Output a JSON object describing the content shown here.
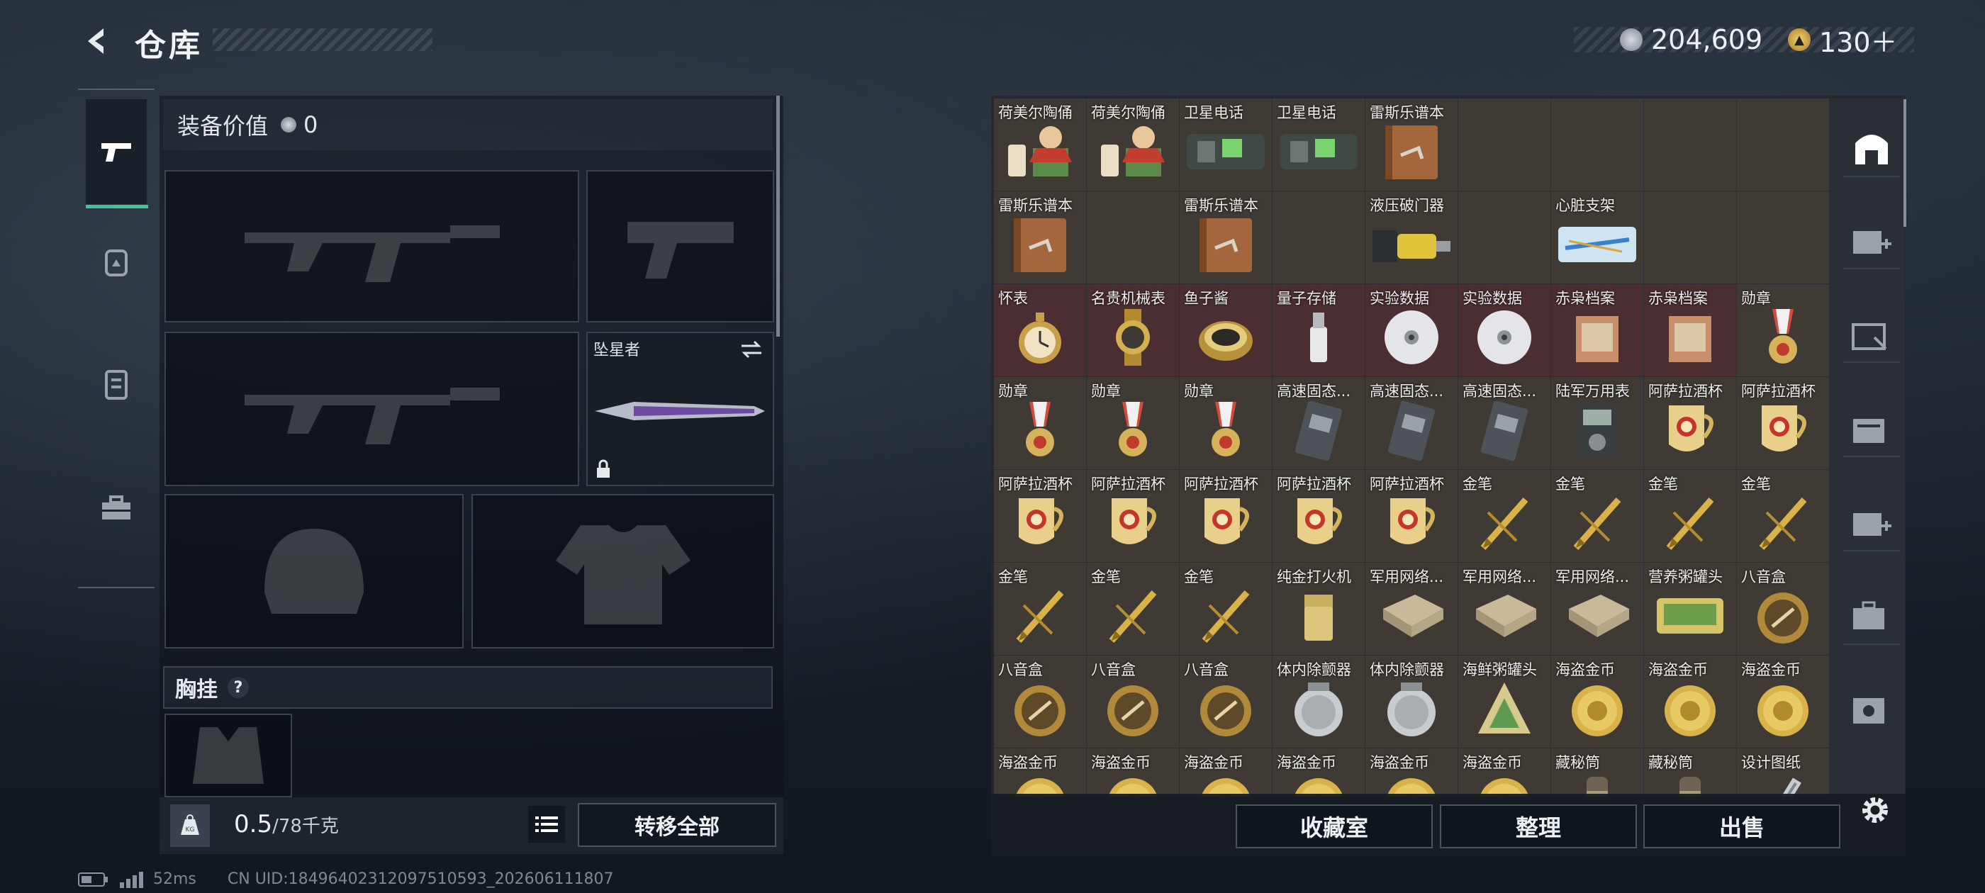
{
  "header": {
    "title": "仓库",
    "currency_silver": "204,609",
    "currency_gold": "130＋"
  },
  "loadout": {
    "value_label": "装备价值",
    "value_amount": "0",
    "melee_label": "坠星者",
    "chest_label": "胸挂",
    "chest_help": "?",
    "weight_current": "0.5",
    "weight_max": "/78千克",
    "transfer_all": "转移全部"
  },
  "inventory": {
    "items": [
      {
        "label": "荷美尔陶俑",
        "icon": "figurine",
        "red": false
      },
      {
        "label": "荷美尔陶俑",
        "icon": "figurine",
        "red": false
      },
      {
        "label": "卫星电话",
        "icon": "phone",
        "red": false
      },
      {
        "label": "卫星电话",
        "icon": "phone",
        "red": false
      },
      {
        "label": "雷斯乐谱本",
        "icon": "book",
        "red": false
      },
      {
        "label": "",
        "icon": "none",
        "red": false
      },
      {
        "label": "",
        "icon": "none",
        "red": false
      },
      {
        "label": "",
        "icon": "none",
        "red": false
      },
      {
        "label": "",
        "icon": "none",
        "red": false
      },
      {
        "label": "雷斯乐谱本",
        "icon": "book",
        "red": false
      },
      {
        "label": "",
        "icon": "none",
        "red": false
      },
      {
        "label": "雷斯乐谱本",
        "icon": "book",
        "red": false
      },
      {
        "label": "",
        "icon": "none",
        "red": false
      },
      {
        "label": "液压破门器",
        "icon": "breacher",
        "red": false
      },
      {
        "label": "",
        "icon": "none",
        "red": false
      },
      {
        "label": "心脏支架",
        "icon": "stent",
        "red": false
      },
      {
        "label": "",
        "icon": "none",
        "red": false
      },
      {
        "label": "",
        "icon": "none",
        "red": false
      },
      {
        "label": "怀表",
        "icon": "watch",
        "red": true
      },
      {
        "label": "名贵机械表",
        "icon": "wristwatch",
        "red": true
      },
      {
        "label": "鱼子酱",
        "icon": "caviar",
        "red": true
      },
      {
        "label": "量子存储",
        "icon": "usb",
        "red": true
      },
      {
        "label": "实验数据",
        "icon": "disc",
        "red": true
      },
      {
        "label": "实验数据",
        "icon": "disc",
        "red": true
      },
      {
        "label": "赤枭档案",
        "icon": "file",
        "red": true
      },
      {
        "label": "赤枭档案",
        "icon": "file",
        "red": true
      },
      {
        "label": "勋章",
        "icon": "medal",
        "red": false
      },
      {
        "label": "勋章",
        "icon": "medal",
        "red": false
      },
      {
        "label": "勋章",
        "icon": "medal",
        "red": false
      },
      {
        "label": "勋章",
        "icon": "medal",
        "red": false
      },
      {
        "label": "高速固态...",
        "icon": "ssd",
        "red": false
      },
      {
        "label": "高速固态...",
        "icon": "ssd",
        "red": false
      },
      {
        "label": "高速固态...",
        "icon": "ssd",
        "red": false
      },
      {
        "label": "陆军万用表",
        "icon": "meter",
        "red": false
      },
      {
        "label": "阿萨拉酒杯",
        "icon": "cup",
        "red": false
      },
      {
        "label": "阿萨拉酒杯",
        "icon": "cup",
        "red": false
      },
      {
        "label": "阿萨拉酒杯",
        "icon": "cup",
        "red": false
      },
      {
        "label": "阿萨拉酒杯",
        "icon": "cup",
        "red": false
      },
      {
        "label": "阿萨拉酒杯",
        "icon": "cup",
        "red": false
      },
      {
        "label": "阿萨拉酒杯",
        "icon": "cup",
        "red": false
      },
      {
        "label": "阿萨拉酒杯",
        "icon": "cup",
        "red": false
      },
      {
        "label": "金笔",
        "icon": "pen",
        "red": false
      },
      {
        "label": "金笔",
        "icon": "pen",
        "red": false
      },
      {
        "label": "金笔",
        "icon": "pen",
        "red": false
      },
      {
        "label": "金笔",
        "icon": "pen",
        "red": false
      },
      {
        "label": "金笔",
        "icon": "pen",
        "red": false
      },
      {
        "label": "金笔",
        "icon": "pen",
        "red": false
      },
      {
        "label": "金笔",
        "icon": "pen",
        "red": false
      },
      {
        "label": "纯金打火机",
        "icon": "lighter",
        "red": false
      },
      {
        "label": "军用网络...",
        "icon": "router",
        "red": false
      },
      {
        "label": "军用网络...",
        "icon": "router",
        "red": false
      },
      {
        "label": "军用网络...",
        "icon": "router",
        "red": false
      },
      {
        "label": "营养粥罐头",
        "icon": "can",
        "red": false
      },
      {
        "label": "八音盒",
        "icon": "musicbox",
        "red": false
      },
      {
        "label": "八音盒",
        "icon": "musicbox",
        "red": false
      },
      {
        "label": "八音盒",
        "icon": "musicbox",
        "red": false
      },
      {
        "label": "八音盒",
        "icon": "musicbox",
        "red": false
      },
      {
        "label": "体内除颤器",
        "icon": "defib",
        "red": false
      },
      {
        "label": "体内除颤器",
        "icon": "defib",
        "red": false
      },
      {
        "label": "海鲜粥罐头",
        "icon": "seacan",
        "red": false
      },
      {
        "label": "海盗金币",
        "icon": "coin",
        "red": false
      },
      {
        "label": "海盗金币",
        "icon": "coin",
        "red": false
      },
      {
        "label": "海盗金币",
        "icon": "coin",
        "red": false
      },
      {
        "label": "海盗金币",
        "icon": "coin",
        "red": false
      },
      {
        "label": "海盗金币",
        "icon": "coin",
        "red": false
      },
      {
        "label": "海盗金币",
        "icon": "coin",
        "red": false
      },
      {
        "label": "海盗金币",
        "icon": "coin",
        "red": false
      },
      {
        "label": "海盗金币",
        "icon": "coin",
        "red": false
      },
      {
        "label": "海盗金币",
        "icon": "coin",
        "red": false
      },
      {
        "label": "藏秘筒",
        "icon": "tube",
        "red": false
      },
      {
        "label": "藏秘筒",
        "icon": "tube",
        "red": false
      },
      {
        "label": "设计图纸",
        "icon": "blueprint",
        "red": false
      }
    ]
  },
  "actions": {
    "collection": "收藏室",
    "organize": "整理",
    "sell": "出售"
  },
  "status": {
    "ping": "52ms",
    "uid": "CN UID:18496402312097510593_202606111807"
  }
}
